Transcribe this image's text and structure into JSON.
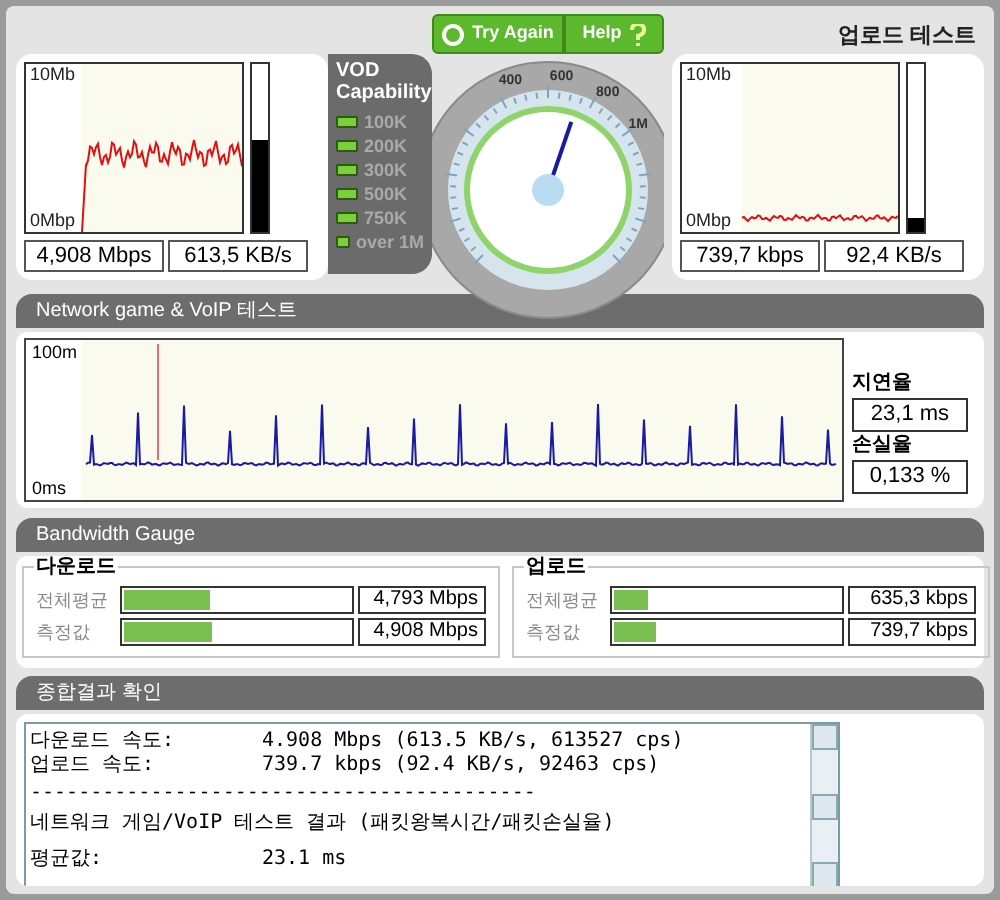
{
  "download_test": {
    "y_max": "10Mb",
    "y_min": "0Mbp",
    "meter": {
      "level": 0.55
    },
    "readings": [
      "4,908 Mbps",
      "613,5 KB/s"
    ]
  },
  "vod_capability": {
    "title": "VOD Capability",
    "items": [
      "100K",
      "200K",
      "300K",
      "500K",
      "750K",
      "over 1M"
    ]
  },
  "gauge": {
    "buttons": [
      {
        "label": "Try Again",
        "kind": "retry"
      },
      {
        "label": "Help",
        "kind": "help"
      }
    ],
    "scale_labels": [
      "400",
      "600",
      "800",
      "1M"
    ],
    "level": 0.57
  },
  "upload_test": {
    "title": "업로드 테스트",
    "y_max": "10Mb",
    "y_min": "0Mbp",
    "meter": {
      "level": 0.08
    },
    "readings": [
      "739,7 kbps",
      "92,4 KB/s"
    ]
  },
  "network_test": {
    "title": "Network game & VoIP 테스트",
    "y_max": "100m",
    "y_min": "0ms",
    "latency": {
      "label": "지연율",
      "value": "23,1 ms"
    },
    "loss": {
      "label": "손실율",
      "value": "0,133 %"
    }
  },
  "bandwidth_gauge": {
    "title": "Bandwidth Gauge",
    "groups": [
      {
        "title": "다운로드",
        "rows": [
          {
            "label": "전체평균",
            "level": 0.38,
            "value": "4,793 Mbps"
          },
          {
            "label": "측정값",
            "level": 0.39,
            "value": "4,908 Mbps"
          }
        ]
      },
      {
        "title": "업로드",
        "rows": [
          {
            "label": "전체평균",
            "level": 0.15,
            "value": "635,3 kbps"
          },
          {
            "label": "측정값",
            "level": 0.19,
            "value": "739,7 kbps"
          }
        ]
      }
    ]
  },
  "summary": {
    "title": "종합결과 확인",
    "lines": [
      {
        "kind": "pair",
        "label": "다운로드 속도:",
        "value": "4.908 Mbps (613.5 KB/s, 613527 cps)"
      },
      {
        "kind": "pair",
        "label": "업로드 속도:",
        "value": "739.7 kbps (92.4 KB/s, 92463 cps)"
      },
      {
        "kind": "text",
        "text": "------------------------------------------"
      },
      {
        "kind": "text",
        "text": "네트워크 게임/VoIP 테스트 결과 (패킷왕복시간/패킷손실율)"
      },
      {
        "kind": "blank"
      },
      {
        "kind": "pair",
        "label": "평균값:",
        "value": "23.1 ms"
      }
    ]
  }
}
